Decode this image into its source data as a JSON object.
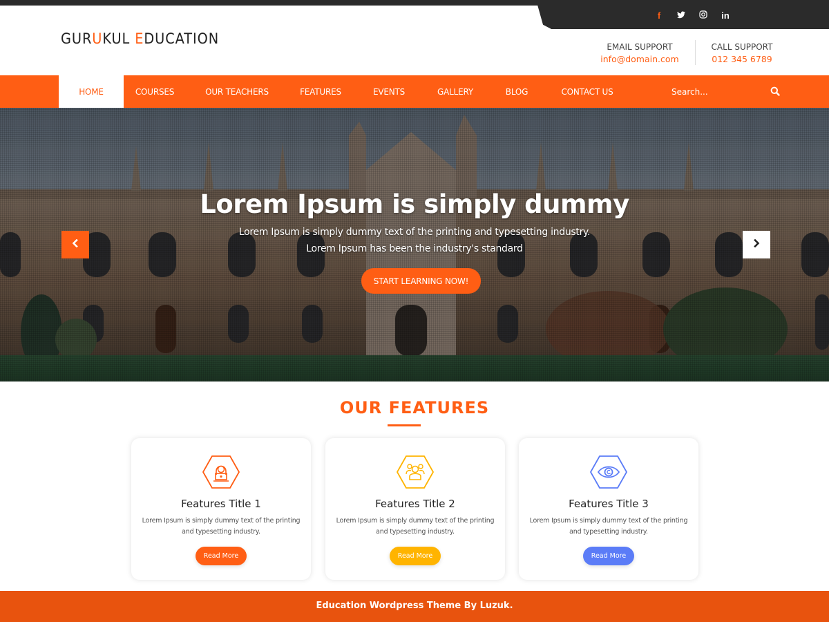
{
  "social": [
    {
      "name": "facebook",
      "glyph": "f"
    },
    {
      "name": "twitter",
      "glyph": "🐦"
    },
    {
      "name": "instagram",
      "glyph": "◎"
    },
    {
      "name": "linkedin",
      "glyph": "in"
    }
  ],
  "brand": {
    "part1": "GUR",
    "accent1": "U",
    "part2": "KUL ",
    "accent2": "E",
    "part3": "DUCATION",
    "accent_color": "#ff5e14"
  },
  "support": {
    "email_label": "EMAIL SUPPORT",
    "email_value": "info@domain.com",
    "call_label": "CALL SUPPORT",
    "call_value": "012 345 6789"
  },
  "nav": {
    "items": [
      "HOME",
      "COURSES",
      "OUR TEACHERS",
      "FEATURES",
      "EVENTS",
      "GALLERY",
      "BLOG",
      "CONTACT US"
    ],
    "active": "HOME",
    "search_placeholder": "Search..."
  },
  "hero": {
    "title": "Lorem Ipsum is simply dummy",
    "subtitle_line1": "Lorem Ipsum is simply dummy text of the printing and typesetting industry.",
    "subtitle_line2": "Lorem Ipsum has been the industry's standard",
    "cta": "START LEARNING NOW!"
  },
  "features": {
    "heading": "OUR FEATURES",
    "cards": [
      {
        "title": "Features Title 1",
        "desc_line1": "Lorem Ipsum is simply dummy text of the printing",
        "desc_line2": "and typesetting industry.",
        "button": "Read More",
        "icon": "student-laptop-icon",
        "color": "#ff5e14"
      },
      {
        "title": "Features Title 2",
        "desc_line1": "Lorem Ipsum is simply dummy text of the printing",
        "desc_line2": "and typesetting industry.",
        "button": "Read More",
        "icon": "group-icon",
        "color": "#ffb400"
      },
      {
        "title": "Features Title 3",
        "desc_line1": "Lorem Ipsum is simply dummy text of the printing",
        "desc_line2": "and typesetting industry.",
        "button": "Read More",
        "icon": "eye-icon",
        "color": "#5b7cf7"
      }
    ]
  },
  "footer": {
    "text": "Education Wordpress Theme By Luzuk."
  },
  "colors": {
    "primary": "#ff5e14",
    "dark": "#2b2b2b",
    "footer": "#e8530e"
  }
}
